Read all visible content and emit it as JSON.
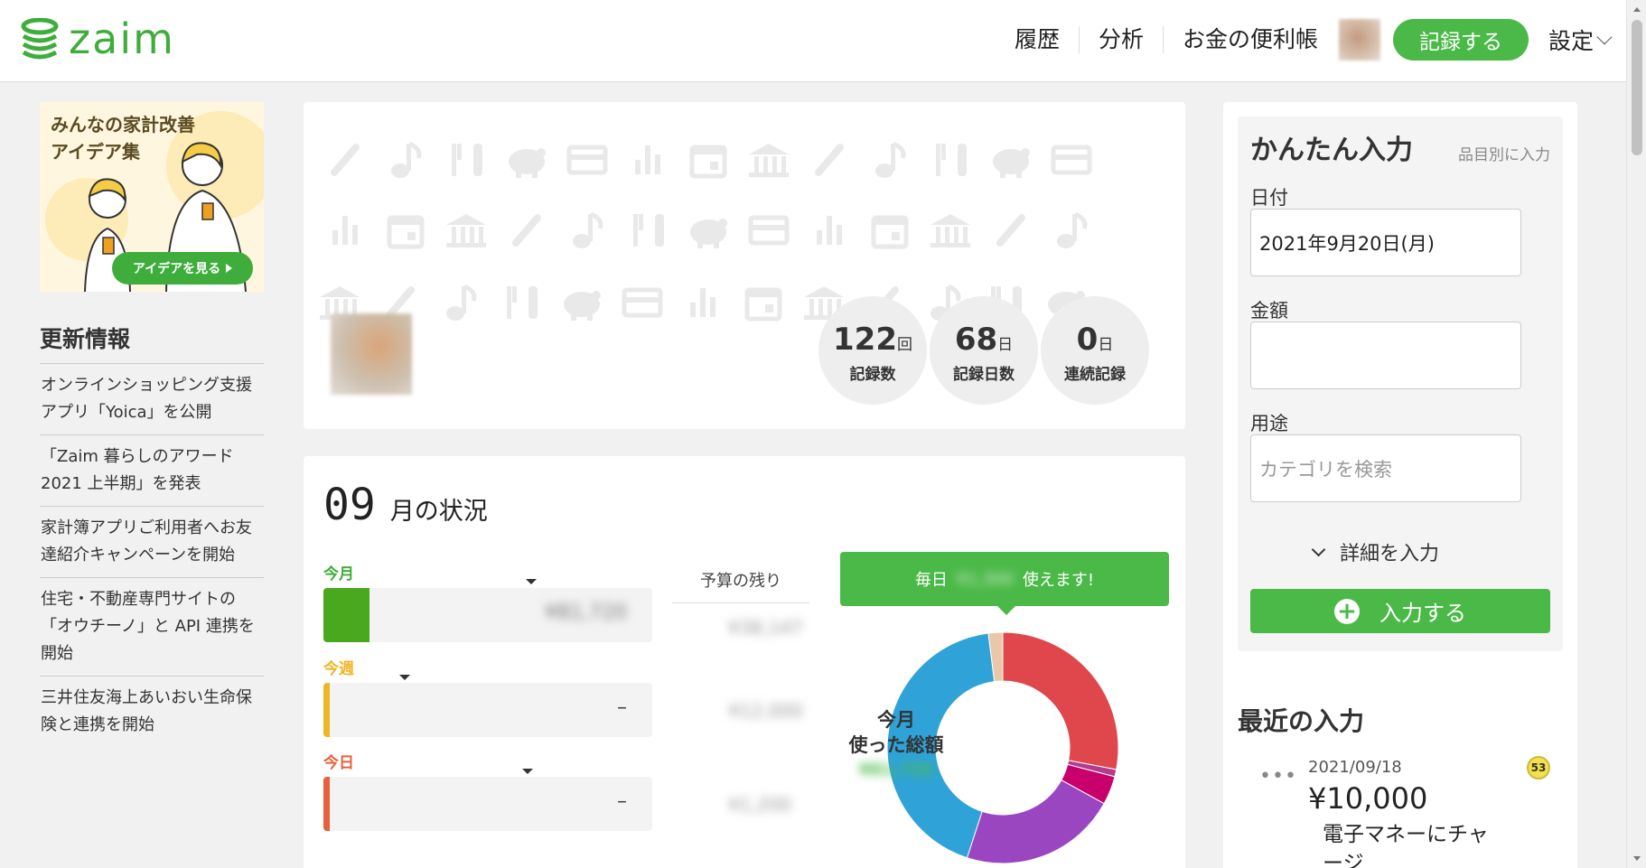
{
  "brand": {
    "name": "zaim",
    "color": "#3fad3b"
  },
  "header": {
    "nav": [
      "履歴",
      "分析",
      "お金の便利帳"
    ],
    "record_button": "記録する",
    "settings": "設定"
  },
  "banner": {
    "title_line1": "みんなの家計改善",
    "title_line2": "アイデア集",
    "button": "アイデアを見る"
  },
  "updates": {
    "title": "更新情報",
    "items": [
      "オンラインショッピング支援アプリ「Yoica」を公開",
      "「Zaim 暮らしのアワード 2021 上半期」を発表",
      "家計簿アプリご利用者へお友達紹介キャンペーンを開始",
      "住宅・不動産専門サイトの「オウチーノ」と API 連携を開始",
      "三井住友海上あいおい生命保険と連携を開始"
    ]
  },
  "stats": [
    {
      "num": "122",
      "unit": "回",
      "label": "記録数"
    },
    {
      "num": "68",
      "unit": "日",
      "label": "記録日数"
    },
    {
      "num": "0",
      "unit": "日",
      "label": "連続記録"
    }
  ],
  "monthly": {
    "month": "09",
    "title": "月の状況",
    "remaining_label": "予算の残り",
    "periods": [
      {
        "label": "今月",
        "color": "#3fad3b",
        "fill_color": "#4aa81e",
        "value": "¥81,720",
        "fill": 0.14,
        "remaining": "¥38,147"
      },
      {
        "label": "今週",
        "color": "#f0b427",
        "fill_color": "#f0b427",
        "value": "–",
        "fill": 0.0,
        "remaining": "¥12,000"
      },
      {
        "label": "今日",
        "color": "#e8603c",
        "fill_color": "#e8603c",
        "value": "–",
        "fill": 0.0,
        "remaining": "¥1,200"
      }
    ],
    "tooltip_prefix": "毎日",
    "tooltip_value": "¥1,300",
    "tooltip_suffix": "使えます!",
    "donut_line1": "今月",
    "donut_line2": "使った総額",
    "donut_total": "¥81,720",
    "donut_slices": [
      {
        "color": "#e0474c",
        "value": 28
      },
      {
        "color": "#b33b8f",
        "value": 1
      },
      {
        "color": "#c9006b",
        "value": 4
      },
      {
        "color": "#9b46c1",
        "value": 22
      },
      {
        "color": "#2fa3d8",
        "value": 43
      },
      {
        "color": "#e8c8a8",
        "value": 2
      }
    ]
  },
  "quick_input": {
    "title": "かんたん入力",
    "item_link": "品目別に入力",
    "date_label": "日付",
    "date_value": "2021年9月20日(月)",
    "amount_label": "金額",
    "amount_value": "",
    "category_label": "用途",
    "category_placeholder": "カテゴリを検索",
    "details": "詳細を入力",
    "submit": "入力する"
  },
  "recent": {
    "title": "最近の入力",
    "date": "2021/09/18",
    "amount": "¥10,000",
    "category": "電子マネーにチャージ",
    "badge": "53"
  }
}
